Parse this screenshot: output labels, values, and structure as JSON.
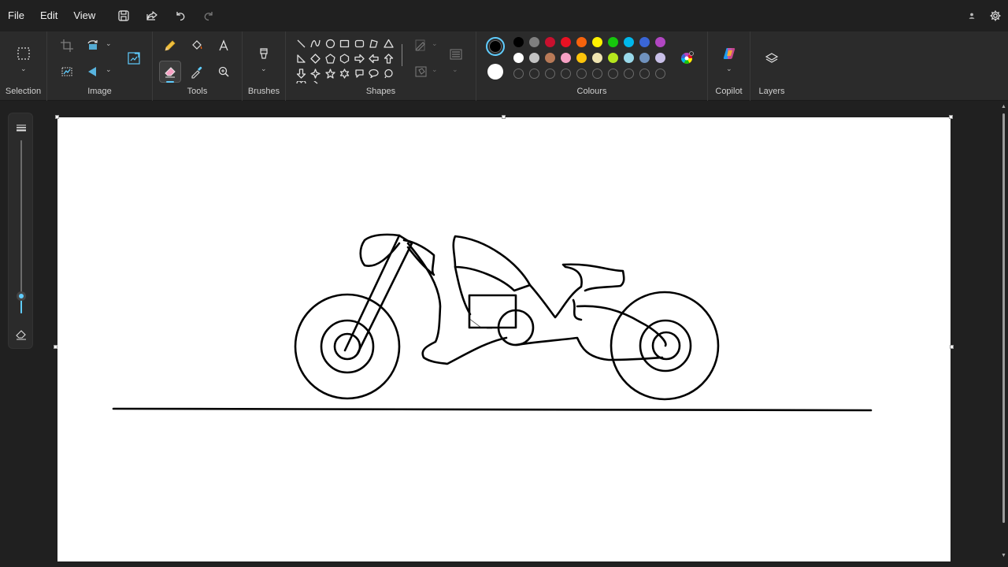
{
  "menu": {
    "file": "File",
    "edit": "Edit",
    "view": "View"
  },
  "quick_access": {
    "icons": [
      "save-icon",
      "share-icon",
      "undo-icon",
      "redo-icon"
    ]
  },
  "ribbon": {
    "groups": {
      "selection": "Selection",
      "image": "Image",
      "tools": "Tools",
      "brushes": "Brushes",
      "shapes": "Shapes",
      "colours": "Colours",
      "copilot": "Copilot",
      "layers": "Layers"
    },
    "active_tool": "eraser"
  },
  "colours": {
    "primary": "#000000",
    "secondary": "#ffffff",
    "row1": [
      "#000000",
      "#7f7f7f",
      "#c8102e",
      "#e81123",
      "#f7630c",
      "#fff100",
      "#16c60c",
      "#00b7eb",
      "#3a66d6",
      "#b146c2"
    ],
    "row2": [
      "#ffffff",
      "#c3c3c3",
      "#b97a57",
      "#f7a1c4",
      "#fdc40b",
      "#efe4b0",
      "#b5e61d",
      "#99d9ea",
      "#7092be",
      "#c8bfe7"
    ],
    "row3_custom_empty": 10,
    "accent": "#60cdff"
  },
  "brush_size_level": 0.1
}
